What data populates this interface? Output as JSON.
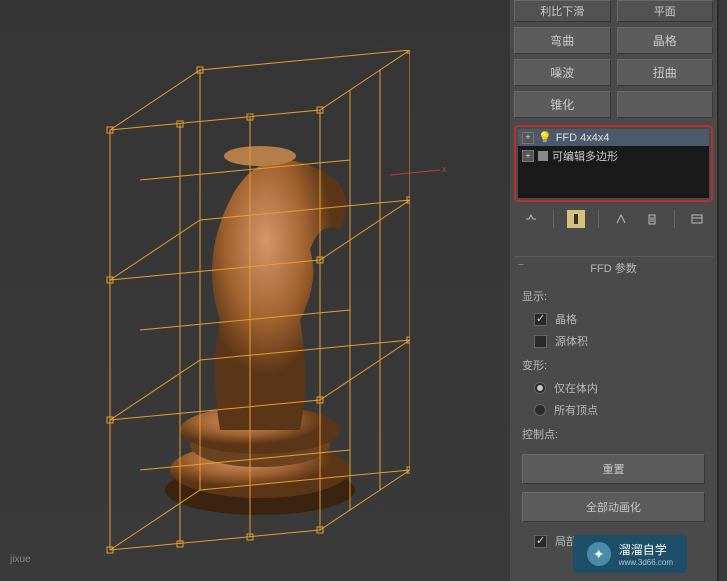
{
  "modifiers": {
    "row1a": "利比下滑",
    "row1b": "平面",
    "row2a": "弯曲",
    "row2b": "晶格",
    "row3a": "噪波",
    "row3b": "扭曲",
    "row4a": "锥化",
    "row4b": ""
  },
  "stack": {
    "items": [
      {
        "label": "FFD 4x4x4",
        "selected": true
      },
      {
        "label": "可编辑多边形",
        "selected": false
      }
    ]
  },
  "rollout_title": "FFD 参数",
  "display": {
    "label": "显示:",
    "lattice": "晶格",
    "source_volume": "源体积"
  },
  "deform": {
    "label": "变形:",
    "in_volume": "仅在体内",
    "all_vertices": "所有顶点"
  },
  "control_points": {
    "label": "控制点:",
    "reset": "重置",
    "animate_all": "全部动画化",
    "local": "局部点"
  },
  "watermark": {
    "brand": "溜溜自学",
    "url": "www.3d66.com",
    "sub": "jixue"
  }
}
